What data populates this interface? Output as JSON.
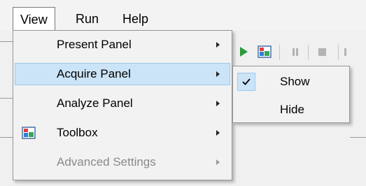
{
  "menubar": {
    "items": [
      {
        "label": "View"
      },
      {
        "label": "Run"
      },
      {
        "label": "Help"
      }
    ]
  },
  "view_menu": {
    "items": [
      {
        "label": "Present Panel",
        "has_submenu": true,
        "enabled": true
      },
      {
        "label": "Acquire Panel",
        "has_submenu": true,
        "enabled": true,
        "highlighted": true
      },
      {
        "label": "Analyze Panel",
        "has_submenu": true,
        "enabled": true
      },
      {
        "label": "Toolbox",
        "has_submenu": true,
        "enabled": true,
        "icon": "toolbox-icon"
      },
      {
        "label": "Advanced Settings",
        "has_submenu": true,
        "enabled": false
      }
    ]
  },
  "acquire_submenu": {
    "items": [
      {
        "label": "Show",
        "checked": true
      },
      {
        "label": "Hide",
        "checked": false
      }
    ]
  },
  "colors": {
    "highlight_bg": "#cce4f7",
    "highlight_border": "#99c9ef",
    "play_green": "#2c9a3a",
    "disabled_text": "#8a8a8a"
  }
}
